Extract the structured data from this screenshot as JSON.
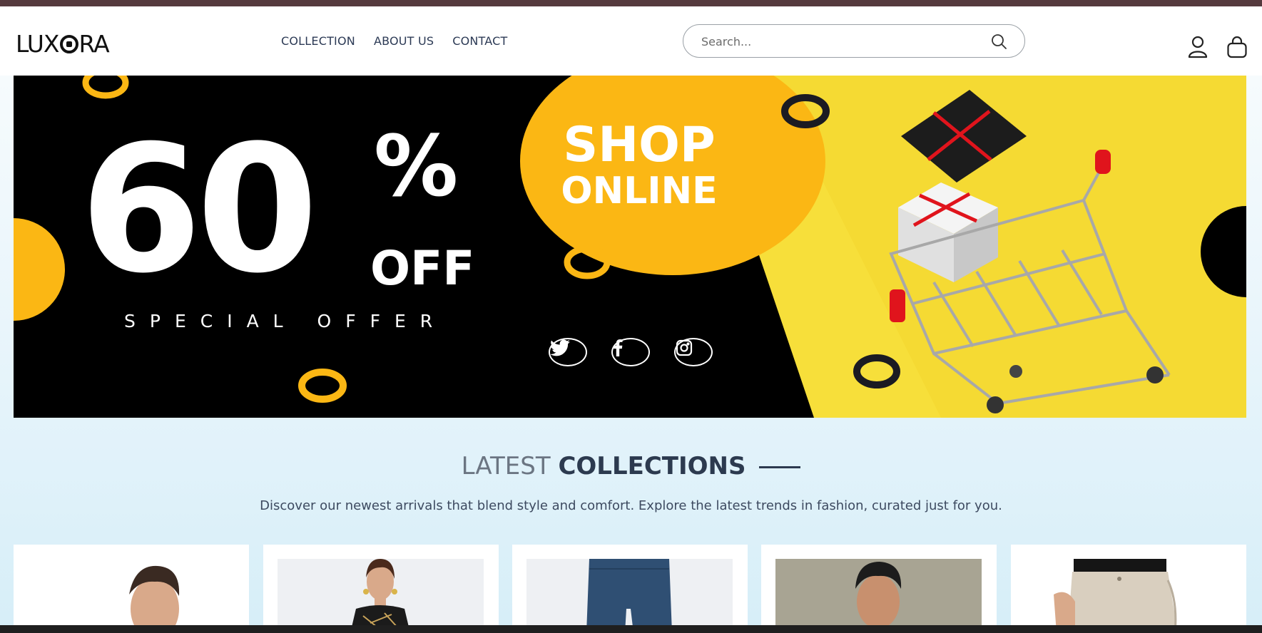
{
  "brand": {
    "logo_text_left": "LUX",
    "logo_text_right": "RA"
  },
  "nav": {
    "items": [
      "COLLECTION",
      "ABOUT US",
      "CONTACT"
    ]
  },
  "search": {
    "placeholder": "Search..."
  },
  "icons": {
    "search": "search-icon",
    "user": "user-icon",
    "bag": "shopping-bag-icon"
  },
  "banner": {
    "discount_number": "60",
    "discount_percent": "%",
    "discount_off": "OFF",
    "special_offer": "SPECIAL OFFER",
    "shop_line1": "SHOP",
    "shop_line2": "ONLINE",
    "social": [
      "twitter-icon",
      "facebook-icon",
      "instagram-icon"
    ]
  },
  "collections": {
    "title_light": "LATEST",
    "title_bold": "COLLECTIONS",
    "description": "Discover our newest arrivals that blend style and comfort. Explore the latest trends in fashion, curated just for you."
  },
  "products": [
    "product-man-portrait",
    "product-woman-dress",
    "product-denim-shorts",
    "product-man-sweater",
    "product-beige-pants"
  ],
  "colors": {
    "topbar": "#553a3e",
    "banner_yellow": "#fbb714",
    "text_dark": "#2c3a4f"
  }
}
